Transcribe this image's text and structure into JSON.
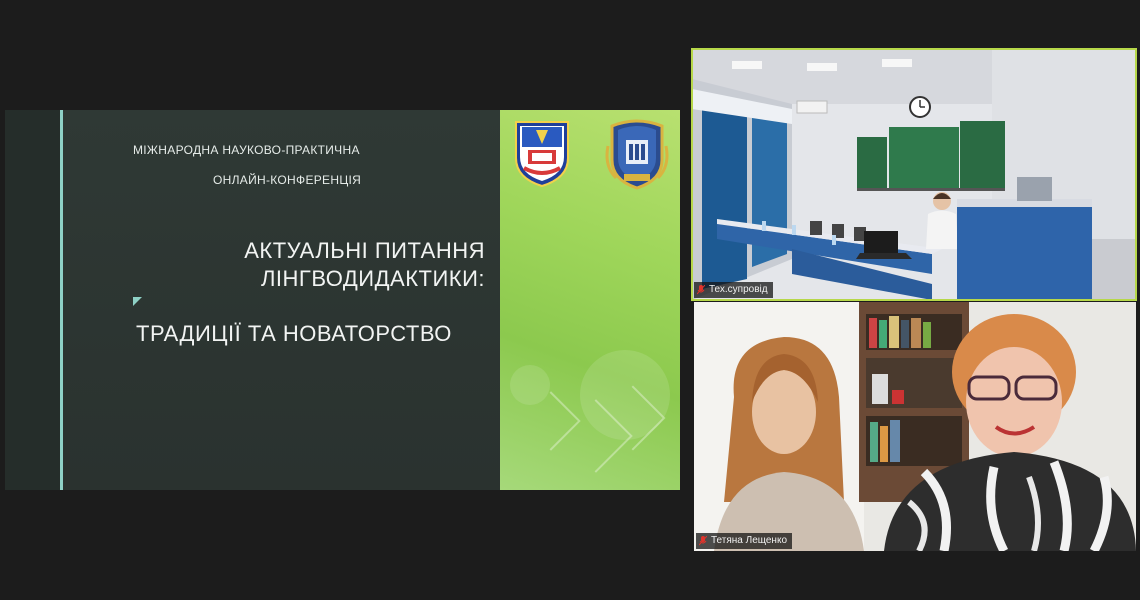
{
  "slide": {
    "line1": "МІЖНАРОДНА НАУКОВО-ПРАКТИЧНА",
    "line2": "ОНЛАЙН-КОНФЕРЕНЦІЯ",
    "title_line1": "АКТУАЛЬНІ ПИТАННЯ",
    "title_line2": "ЛІНГВОДИДАКТИКИ:",
    "subtitle": "ТРАДИЦІЇ ТА НОВАТОРСТВО",
    "logos": [
      "university-crest-left",
      "university-crest-right"
    ]
  },
  "participants": [
    {
      "name": "Тех.супровід",
      "active_speaker": true,
      "mic": "muted",
      "icon": "mic-muted-icon"
    },
    {
      "name": "Тетяна Лещенко",
      "active_speaker": false,
      "mic": "muted",
      "icon": "mic-muted-icon"
    }
  ],
  "colors": {
    "background": "#1c1c1c",
    "active_speaker_border": "#b7d84a",
    "slide_accent": "#8ed1c6",
    "slide_green": "#9fd65a",
    "muted_mic": "#e0342c"
  }
}
